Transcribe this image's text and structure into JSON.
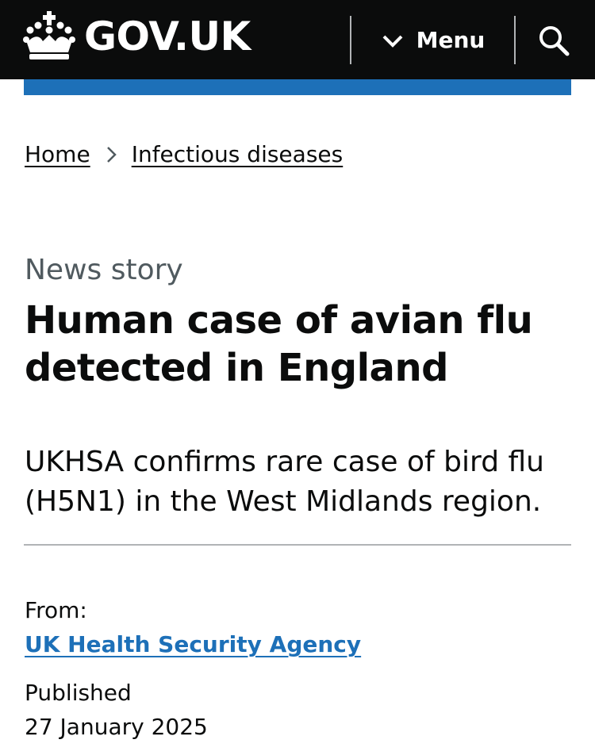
{
  "header": {
    "logo_text": "GOV.UK",
    "menu_label": "Menu",
    "background_color": "#0b0c0c",
    "accent_bar_color": "#1d70b8"
  },
  "breadcrumb": {
    "items": [
      {
        "label": "Home"
      },
      {
        "label": "Infectious diseases"
      }
    ]
  },
  "article": {
    "caption": "News story",
    "title": "Human case of avian flu detected in England",
    "lead": "UKHSA confirms rare case of bird flu (H5N1) in the West Midlands region."
  },
  "metadata": {
    "from_label": "From:",
    "from_org": "UK Health Security Agency",
    "published_label": "Published",
    "published_date": "27 January 2025",
    "link_color": "#1d70b8"
  },
  "icons": {
    "logo": "crown-icon",
    "menu": "chevron-down-icon",
    "search": "search-icon",
    "breadcrumb_separator": "chevron-right-icon"
  }
}
